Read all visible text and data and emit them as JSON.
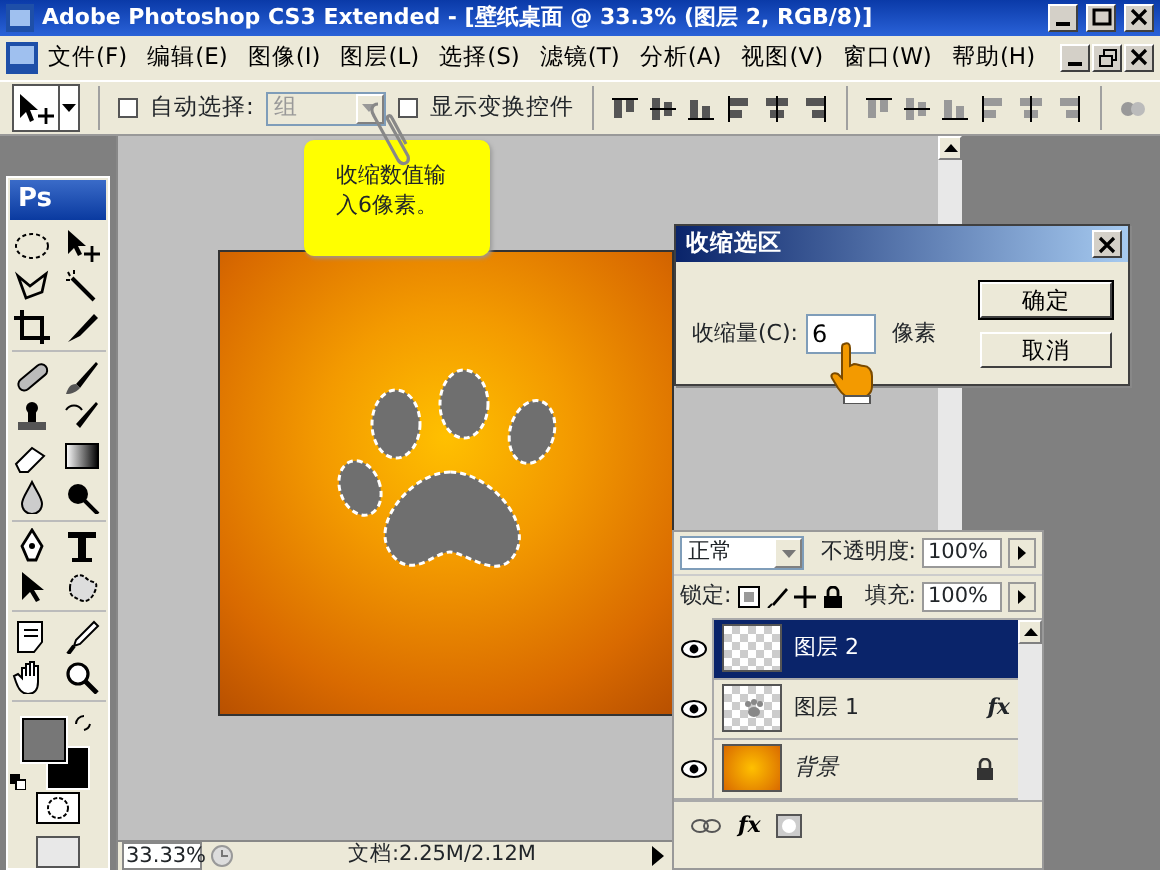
{
  "window": {
    "title": "Adobe Photoshop CS3 Extended - [壁纸桌面 @ 33.3% (图层 2, RGB/8)]"
  },
  "menu": [
    "文件(F)",
    "编辑(E)",
    "图像(I)",
    "图层(L)",
    "选择(S)",
    "滤镜(T)",
    "分析(A)",
    "视图(V)",
    "窗口(W)",
    "帮助(H)"
  ],
  "options_bar": {
    "auto_select": {
      "label": "自动选择:",
      "checked": false
    },
    "auto_select_target": {
      "value": "组",
      "disabled": true
    },
    "show_transform": {
      "label": "显示变换控件",
      "checked": false
    }
  },
  "note": {
    "text": "收缩数值输入6像素。"
  },
  "toolbox": {
    "logo": "Ps"
  },
  "status_bar": {
    "zoom": "33.33%",
    "doc_info": "文档:2.25M/2.12M"
  },
  "dialog": {
    "title": "收缩选区",
    "field_label": "收缩量(C):",
    "value": "6",
    "unit": "像素",
    "buttons": [
      {
        "label": "确定",
        "default": true
      },
      {
        "label": "取消",
        "default": false
      }
    ]
  },
  "layers_panel": {
    "blend_mode": "正常",
    "opacity_label": "不透明度:",
    "opacity": "100%",
    "lock_label": "锁定:",
    "fill_label": "填充:",
    "fill": "100%",
    "bottom_fx": "fx",
    "layers": [
      {
        "name": "图层 2",
        "kind": "empty",
        "selected": true,
        "visible": true,
        "locked": false
      },
      {
        "name": "图层 1",
        "kind": "paw",
        "selected": false,
        "visible": true,
        "locked": false,
        "effects": "fx"
      },
      {
        "name": "背景",
        "kind": "background",
        "selected": false,
        "visible": true,
        "locked": true
      }
    ]
  }
}
